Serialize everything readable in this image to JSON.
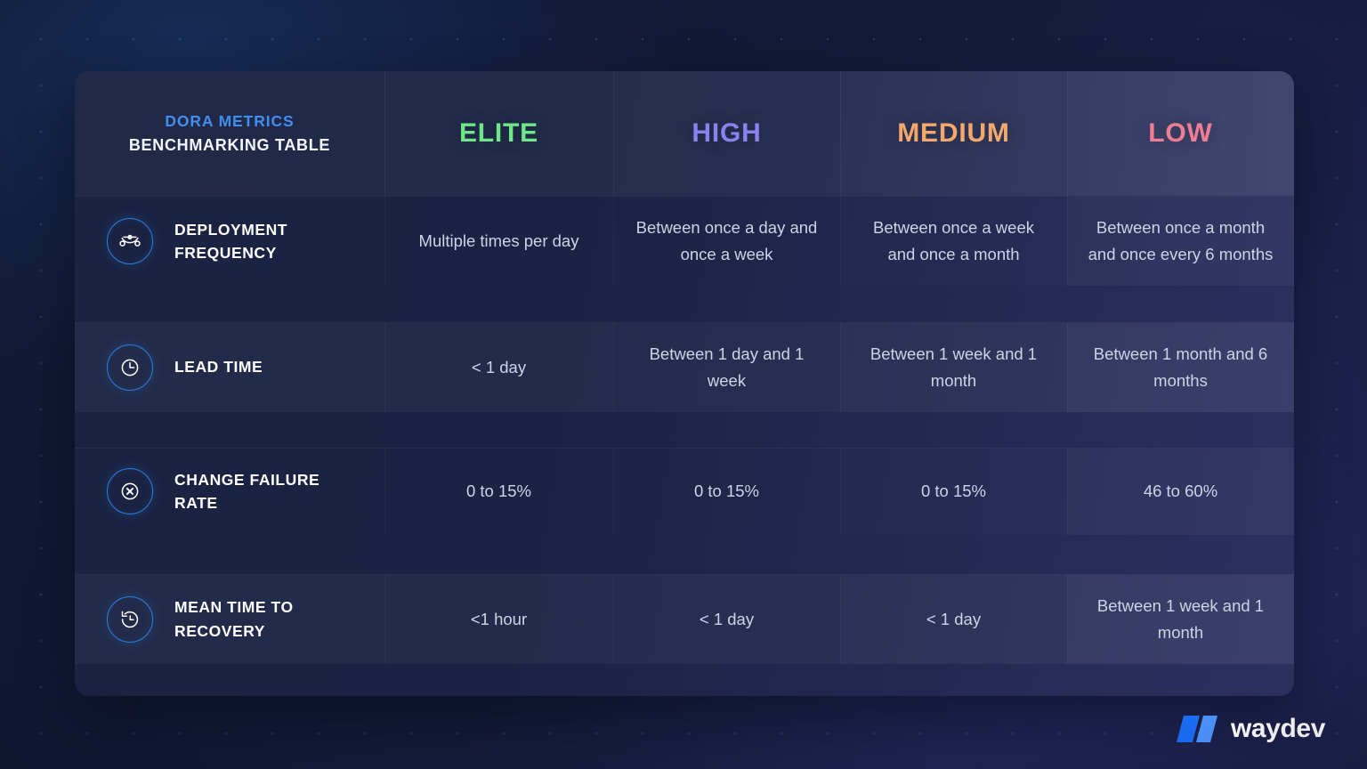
{
  "card": {
    "title": {
      "eyebrow": "DORA METRICS",
      "main": "BENCHMARKING TABLE"
    },
    "tiers": [
      {
        "label": "ELITE",
        "color": "#6ee787"
      },
      {
        "label": "HIGH",
        "color": "#8b82f0"
      },
      {
        "label": "MEDIUM",
        "color": "#f5a86b"
      },
      {
        "label": "LOW",
        "color": "#ef7d94"
      }
    ],
    "rows": [
      {
        "icon": "bezier-curve-icon",
        "metric": "DEPLOYMENT FREQUENCY",
        "elite": "Multiple times per day",
        "high": "Between once a day and once a week",
        "medium": "Between once a week and once a month",
        "low": "Between once a month and once every 6 months"
      },
      {
        "icon": "clock-icon",
        "metric": "LEAD TIME",
        "elite": "< 1 day",
        "high": "Between 1 day and 1 week",
        "medium": "Between 1 week and 1 month",
        "low": "Between 1 month and 6 months"
      },
      {
        "icon": "x-circle-icon",
        "metric": "CHANGE FAILURE RATE",
        "elite": "0 to 15%",
        "high": "0 to 15%",
        "medium": "0 to 15%",
        "low": "46 to 60%"
      },
      {
        "icon": "clock-history-icon",
        "metric": "MEAN TIME TO RECOVERY",
        "elite": "<1 hour",
        "high": "< 1 day",
        "medium": "< 1 day",
        "low": "Between 1 week and 1 month"
      }
    ]
  },
  "logo": {
    "text": "waydev",
    "mark_color_dark": "#1a6ef5",
    "mark_color_light": "#4d94ff"
  },
  "chart_data": {
    "type": "table",
    "title": "DORA METRICS BENCHMARKING TABLE",
    "columns": [
      "DORA METRICS",
      "ELITE",
      "HIGH",
      "MEDIUM",
      "LOW"
    ],
    "rows": [
      [
        "DEPLOYMENT FREQUENCY",
        "Multiple times per day",
        "Between once a day and once a week",
        "Between once a week and once a month",
        "Between once a month and once every 6 months"
      ],
      [
        "LEAD TIME",
        "< 1 day",
        "Between 1 day and 1 week",
        "Between 1 week and 1 month",
        "Between 1 month and 6 months"
      ],
      [
        "CHANGE FAILURE RATE",
        "0 to 15%",
        "0 to 15%",
        "0 to 15%",
        "46 to 60%"
      ],
      [
        "MEAN TIME TO RECOVERY",
        "<1 hour",
        "< 1 day",
        "< 1 day",
        "Between 1 week and 1 month"
      ]
    ]
  }
}
